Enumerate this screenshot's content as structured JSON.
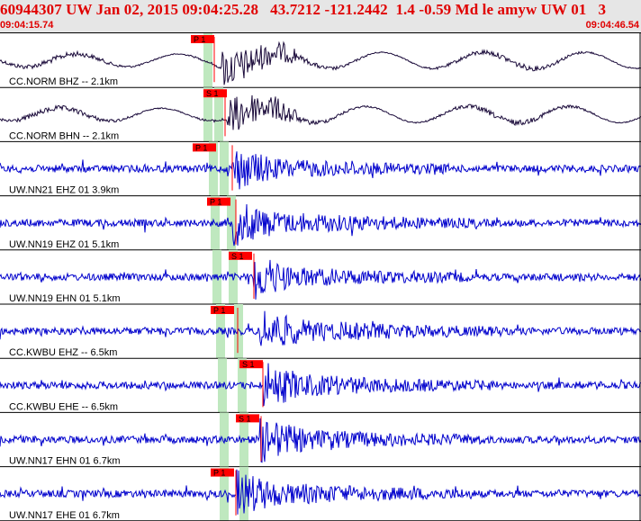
{
  "header": {
    "title": "60944307 UW Jan 02, 2015 09:04:25.28   43.7212 -121.2442  1.4 -0.59 Md le amyw UW 01   3",
    "start_time": "09:04:15.74",
    "end_time": "09:04:46.54"
  },
  "colors": {
    "title": "#e00000",
    "wave_near": "#1a0a3a",
    "wave": "#0000cc",
    "pick": "#ff0000",
    "window": "#bfe8bf",
    "separator": "#000000"
  },
  "traces": [
    {
      "label": "CC.NORM BHZ -- 2.1km",
      "pick": "P 1",
      "type": "near"
    },
    {
      "label": "CC.NORM BHN -- 2.1km",
      "pick": "S 1",
      "type": "near"
    },
    {
      "label": "UW.NN21 EHZ 01 3.9km",
      "pick": "P 1",
      "type": "far"
    },
    {
      "label": "UW.NN19 EHZ 01 5.1km",
      "pick": "P 1",
      "type": "far"
    },
    {
      "label": "UW.NN19 EHN 01 5.1km",
      "pick": "S 1",
      "type": "far"
    },
    {
      "label": "CC.KWBU EHZ -- 6.5km",
      "pick": "P 1",
      "type": "far"
    },
    {
      "label": "CC.KWBU EHE -- 6.5km",
      "pick": "S 1",
      "type": "far"
    },
    {
      "label": "UW.NN17 EHN 01 6.7km",
      "pick": "S 1",
      "type": "far"
    },
    {
      "label": "UW.NN17 EHE 01 6.7km",
      "pick": "P 1",
      "type": "far"
    }
  ]
}
